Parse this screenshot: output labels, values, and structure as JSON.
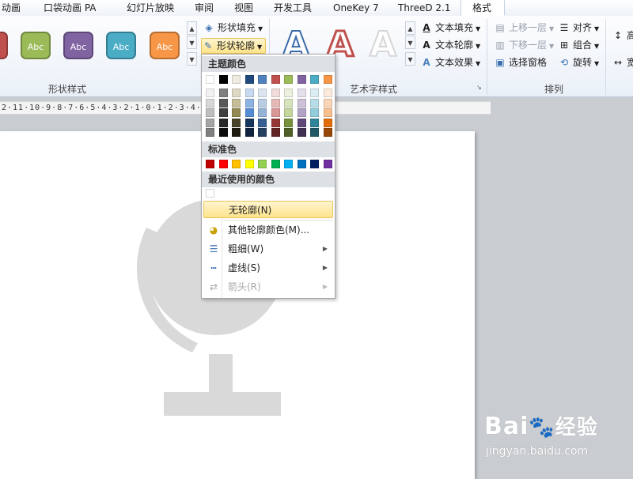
{
  "tabs": [
    {
      "label": "动画",
      "active": false
    },
    {
      "label": "口袋动画 PA",
      "active": false
    },
    {
      "label": "幻灯片放映",
      "active": false
    },
    {
      "label": "审阅",
      "active": false
    },
    {
      "label": "视图",
      "active": false
    },
    {
      "label": "开发工具",
      "active": false
    },
    {
      "label": "OneKey 7",
      "active": false
    },
    {
      "label": "ThreeD 2.1",
      "active": false
    },
    {
      "label": "格式",
      "active": true
    }
  ],
  "shape_styles": {
    "group_label": "形状样式",
    "presets": [
      {
        "label": "",
        "color": "#c0504d"
      },
      {
        "label": "Abc",
        "color": "#9bbb59"
      },
      {
        "label": "Abc",
        "color": "#8064a2"
      },
      {
        "label": "Abc",
        "color": "#4bacc6"
      },
      {
        "label": "Abc",
        "color": "#f79646"
      }
    ],
    "fill_label": "形状填充",
    "outline_label": "形状轮廓"
  },
  "wordart": {
    "group_label": "艺术字样式",
    "text_fill": "文本填充",
    "text_outline": "文本轮廓",
    "text_effects": "文本效果",
    "samples": [
      "A",
      "A",
      "A"
    ]
  },
  "arrange": {
    "group_label": "排列",
    "bring_forward": "上移一层",
    "send_backward": "下移一层",
    "selection_pane": "选择窗格",
    "align": "对齐",
    "group": "组合",
    "rotate": "旋转",
    "height_glyph": "高",
    "width_glyph": "宽"
  },
  "ruler_text": "2·11·10·9·8·7·6·5·4·3·2·1·0·1·2·3·4·5·6·7·8·9·10·11·12·",
  "outline_menu": {
    "theme_colors_header": "主题颜色",
    "standard_colors_header": "标准色",
    "recent_colors_header": "最近使用的颜色",
    "theme_top": [
      "#ffffff",
      "#000000",
      "#eeece1",
      "#1f497d",
      "#4f81bd",
      "#c0504d",
      "#9bbb59",
      "#8064a2",
      "#4bacc6",
      "#f79646"
    ],
    "theme_shades": [
      [
        "#f2f2f2",
        "#7f7f7f",
        "#ddd9c3",
        "#c6d9f0",
        "#dbe5f1",
        "#f2dcdb",
        "#ebf1dd",
        "#e5e0ec",
        "#dbeef3",
        "#fdeada"
      ],
      [
        "#d8d8d8",
        "#595959",
        "#c4bd97",
        "#8db3e2",
        "#b8cce4",
        "#e5b9b7",
        "#d7e3bc",
        "#ccc1d9",
        "#b7dde8",
        "#fbd5b5"
      ],
      [
        "#bfbfbf",
        "#3f3f3f",
        "#938953",
        "#548dd4",
        "#95b3d7",
        "#d99694",
        "#c3d69b",
        "#b2a2c7",
        "#92cddc",
        "#fac08f"
      ],
      [
        "#a5a5a5",
        "#262626",
        "#494429",
        "#17365d",
        "#366092",
        "#953734",
        "#76923c",
        "#5f497a",
        "#31859b",
        "#e36c09"
      ],
      [
        "#7f7f7f",
        "#0c0c0c",
        "#1d1b10",
        "#0f243e",
        "#244061",
        "#632423",
        "#4f6128",
        "#3f3151",
        "#205867",
        "#974806"
      ]
    ],
    "standard": [
      "#c00000",
      "#ff0000",
      "#ffc000",
      "#ffff00",
      "#92d050",
      "#00b050",
      "#00b0f0",
      "#0070c0",
      "#002060",
      "#7030a0"
    ],
    "recent": [
      "#ffffff"
    ],
    "items": {
      "no_outline": "无轮廓(N)",
      "more_colors": "其他轮廓颜色(M)...",
      "weight": "粗细(W)",
      "dashes": "虚线(S)",
      "arrows": "箭头(R)"
    }
  },
  "watermark": {
    "logo": "Bai",
    "logo_suffix": "经验",
    "url": "jingyan.baidu.com"
  }
}
